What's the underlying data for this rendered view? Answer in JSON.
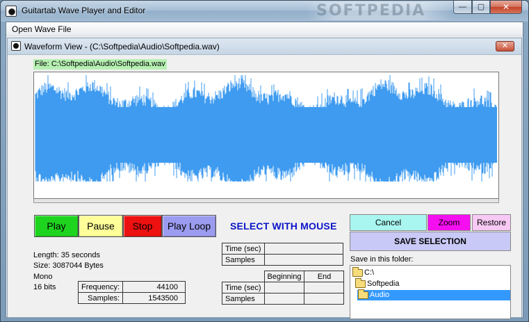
{
  "window": {
    "title": "Guitartab Wave Player and Editor",
    "watermark": "SOFTPEDIA",
    "minimize": "—",
    "maximize": "▢",
    "close": "✕"
  },
  "menu": {
    "open_wave": "Open Wave File"
  },
  "child": {
    "title": "Waveform View - (C:\\Softpedia\\Audio\\Softpedia.wav)",
    "close": "✕"
  },
  "file_label": "File: C:\\Softpedia\\Audio\\Softpedia.wav",
  "playback": {
    "play": "Play",
    "pause": "Pause",
    "stop": "Stop",
    "play_loop": "Play Loop"
  },
  "select_hint": "SELECT WITH MOUSE",
  "selection_buttons": {
    "cancel": "Cancel",
    "zoom": "Zoom",
    "restore": "Restore",
    "save": "SAVE SELECTION"
  },
  "info": {
    "length": "Length: 35 seconds",
    "size": "Size: 3087044 Bytes",
    "channels": "Mono",
    "bits": "16 bits"
  },
  "format_table": {
    "frequency_label": "Frequency:",
    "frequency_value": "44100",
    "samples_label": "Samples:",
    "samples_value": "1543500"
  },
  "selection_table": {
    "time_label": "Time (sec)",
    "samples_label": "Samples",
    "time_value": "",
    "samples_value": ""
  },
  "range_table": {
    "beginning": "Beginning",
    "end": "End",
    "time_label": "Time (sec)",
    "samples_label": "Samples"
  },
  "save_folder": {
    "label": "Save in this folder:",
    "items": [
      "C:\\",
      "Softpedia",
      "Audio"
    ],
    "selected_index": 2
  },
  "colors": {
    "waveform": "#3e9bf0",
    "play": "#1fd41f",
    "pause": "#ffff9a",
    "stop": "#ee1111",
    "play_loop": "#9b9bf0",
    "cancel": "#a8f6ef",
    "zoom": "#f50ff0",
    "restore": "#f8c9f5",
    "save": "#c9c9f7"
  }
}
